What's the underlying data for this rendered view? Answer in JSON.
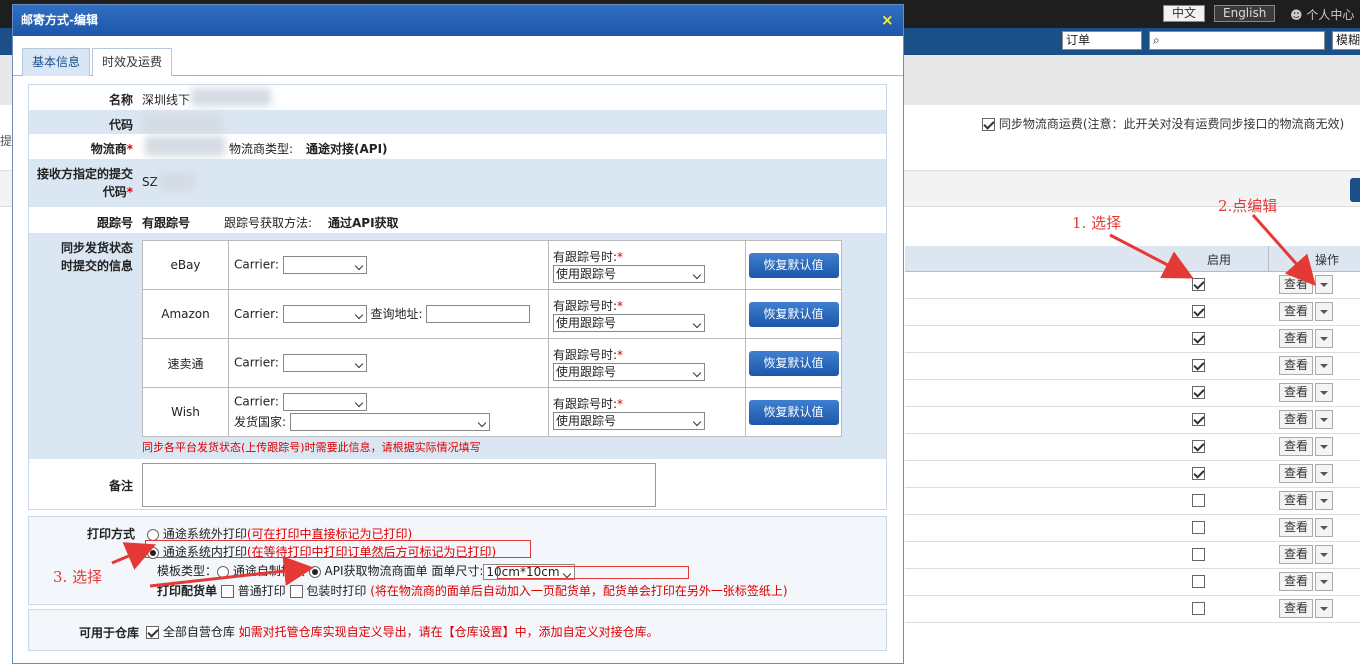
{
  "app": {
    "lang": [
      "中文",
      "English"
    ],
    "user_center": "个人中心",
    "search_select": "订单",
    "fuzzy_btn": "模糊",
    "sync_freight": "同步物流商运费(注意：此开关对没有运费同步接口的物流商无效)",
    "left_char": "提",
    "table_headers": {
      "enabled": "启用",
      "actions": "操作"
    },
    "rows": [
      {
        "enabled": true,
        "view": "查看"
      },
      {
        "enabled": true,
        "view": "查看"
      },
      {
        "enabled": true,
        "view": "查看"
      },
      {
        "enabled": true,
        "view": "查看"
      },
      {
        "enabled": true,
        "view": "查看"
      },
      {
        "enabled": true,
        "view": "查看"
      },
      {
        "enabled": true,
        "view": "查看"
      },
      {
        "enabled": true,
        "view": "查看"
      },
      {
        "enabled": false,
        "view": "查看"
      },
      {
        "enabled": false,
        "view": "查看"
      },
      {
        "enabled": false,
        "view": "查看"
      },
      {
        "enabled": false,
        "view": "查看"
      },
      {
        "enabled": false,
        "view": "查看"
      }
    ]
  },
  "annotations": {
    "a1": "1. 选择",
    "a2": "2.点编辑",
    "a3": "3. 选择",
    "color": "#e53935"
  },
  "modal": {
    "title": "邮寄方式-编辑",
    "close": "×",
    "tabs": [
      "基本信息",
      "时效及运费"
    ],
    "fields": {
      "name_label": "名称",
      "name_value": "深圳线下",
      "code_label": "代码",
      "carrier_label": "物流商",
      "carrier_type_label": "物流商类型:",
      "carrier_type_value": "通途对接(API)",
      "submit_code_label_1": "接收方指定的提交",
      "submit_code_label_2": "代码",
      "submit_code_value": "SZ",
      "tracking_label": "跟踪号",
      "tracking_value": "有跟踪号",
      "tracking_method_label": "跟踪号获取方法:",
      "tracking_method_value": "通过API获取",
      "sync_label_1": "同步发货状态",
      "sync_label_2": "时提交的信息",
      "remark_label": "备注",
      "required_mark": "*"
    },
    "platforms": [
      {
        "name": "eBay",
        "has_tracking": "有跟踪号时:",
        "tracking_sel": "使用跟踪号",
        "reset": "恢复默认值"
      },
      {
        "name": "Amazon",
        "has_tracking": "有跟踪号时:",
        "tracking_sel": "使用跟踪号",
        "reset": "恢复默认值",
        "query_label": "查询地址:"
      },
      {
        "name": "速卖通",
        "has_tracking": "有跟踪号时:",
        "tracking_sel": "使用跟踪号",
        "reset": "恢复默认值"
      },
      {
        "name": "Wish",
        "has_tracking": "有跟踪号时:",
        "tracking_sel": "使用跟踪号",
        "reset": "恢复默认值",
        "country_label": "发货国家:"
      }
    ],
    "carrier_label": "Carrier:",
    "platform_note": "同步各平台发货状态(上传跟踪号)时需要此信息，请根据实际情况填写",
    "print": {
      "label": "打印方式",
      "opt1": "通途系统外打印",
      "opt1_note": "(可在打印中直接标记为已打印)",
      "opt2": "通途系统内打印",
      "opt2_note": "(在等待打印中打印订单然后方可标记为已打印)",
      "template_label": "模板类型：",
      "tpl1": "通途自制模板",
      "tpl2": "API获取物流商面单",
      "size_label": "面单尺寸:",
      "size_value": "10cm*10cm",
      "picklist_label": "打印配货单",
      "pick1": "普通打印",
      "pick2": "包装时打印",
      "pick_note": "(将在物流商的面单后自动加入一页配货单，配货单会打印在另外一张标签纸上)"
    },
    "warehouse": {
      "label": "可用于仓库",
      "option": "全部自营仓库",
      "note": "如需对托管仓库实现自定义导出，请在【仓库设置】中，添加自定义对接仓库。"
    }
  }
}
